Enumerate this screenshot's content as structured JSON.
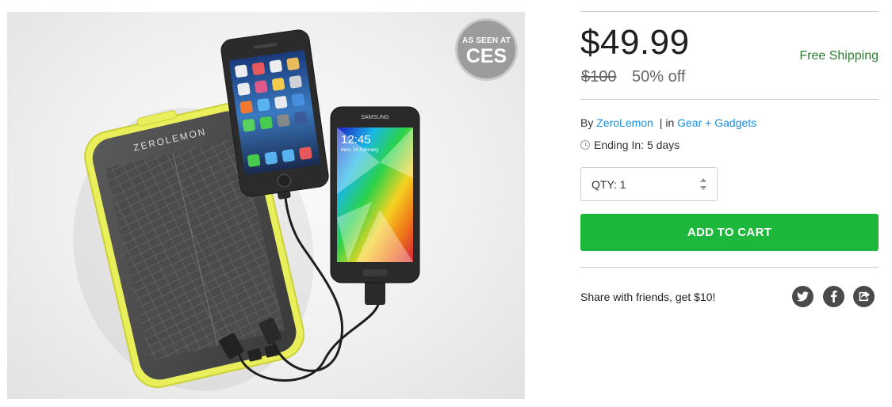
{
  "product": {
    "badge_line1": "AS SEEN AT",
    "badge_line2": "CES",
    "brand_print": "ZEROLEMON",
    "phone_brand": "SAMSUNG",
    "phone_time": "12:45",
    "phone_date": "Mon, 24 February"
  },
  "pricing": {
    "price": "$49.99",
    "original_price": "$100",
    "discount": "50% off",
    "shipping": "Free Shipping"
  },
  "meta": {
    "by_label": "By",
    "vendor": "ZeroLemon",
    "separator": "|",
    "in_label": "in",
    "category": "Gear + Gadgets",
    "ending": "Ending In: 5 days"
  },
  "cart": {
    "qty_label": "QTY: 1",
    "add_label": "ADD TO CART"
  },
  "share": {
    "text": "Share with friends, get $10!",
    "icons": [
      "twitter-icon",
      "facebook-icon",
      "share-icon"
    ]
  },
  "colors": {
    "accent_green": "#1db83b",
    "link_blue": "#1a8fe3",
    "shipping_green": "#2e7d32",
    "social_gray": "#4a4a4a"
  }
}
